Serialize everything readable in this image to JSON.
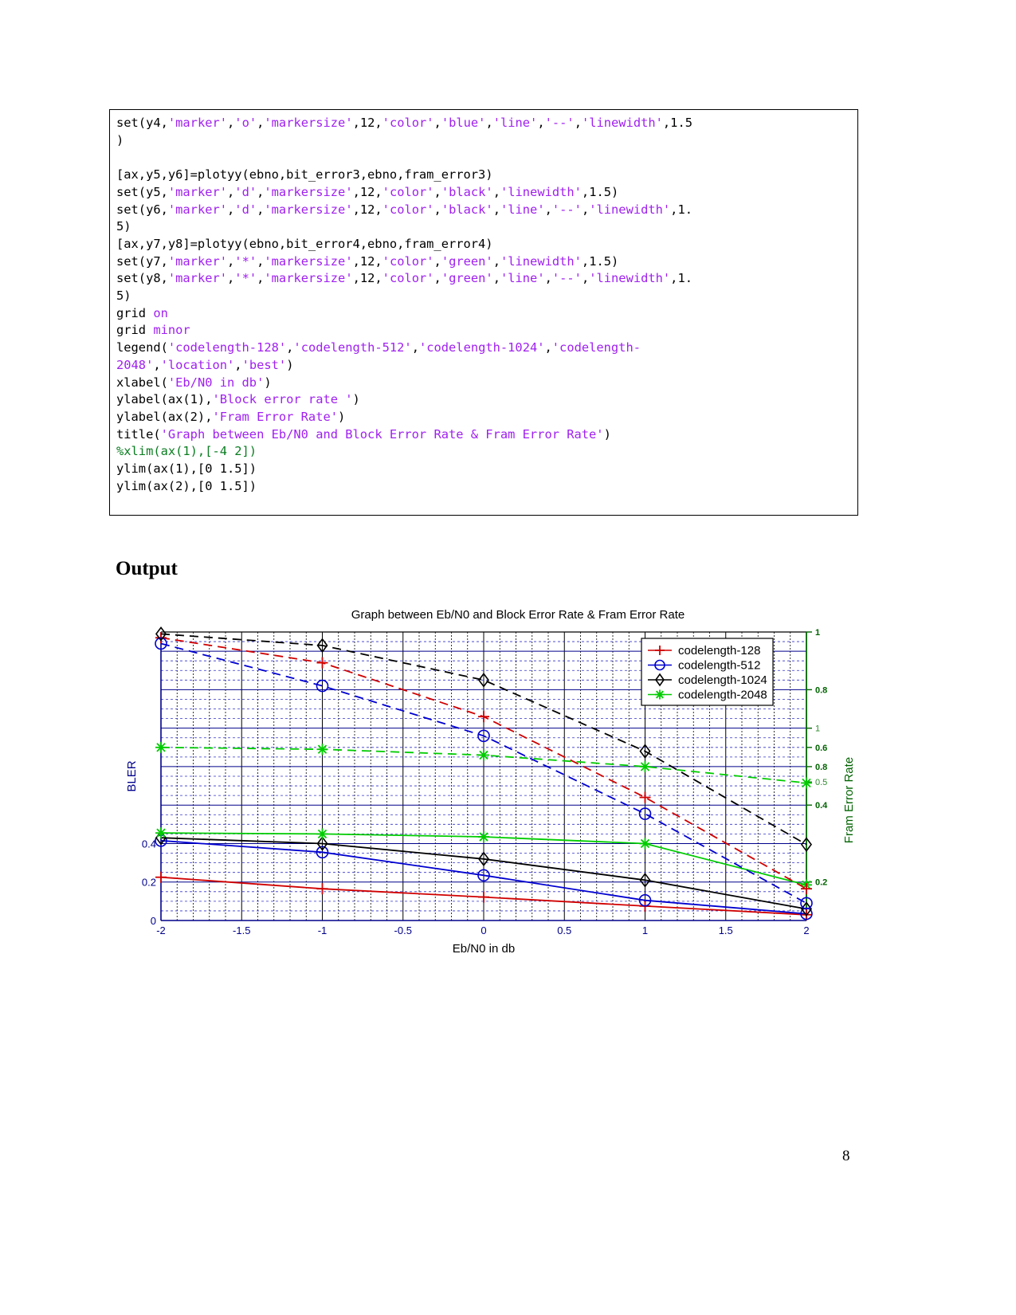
{
  "document": {
    "page_number": "8",
    "output_heading": "Output"
  },
  "code_block": {
    "lines": [
      [
        {
          "t": "set(y4,",
          "k": "p"
        },
        {
          "t": "'marker'",
          "k": "s"
        },
        {
          "t": ",",
          "k": "p"
        },
        {
          "t": "'o'",
          "k": "s"
        },
        {
          "t": ",",
          "k": "p"
        },
        {
          "t": "'markersize'",
          "k": "s"
        },
        {
          "t": ",12,",
          "k": "p"
        },
        {
          "t": "'color'",
          "k": "s"
        },
        {
          "t": ",",
          "k": "p"
        },
        {
          "t": "'blue'",
          "k": "s"
        },
        {
          "t": ",",
          "k": "p"
        },
        {
          "t": "'line'",
          "k": "s"
        },
        {
          "t": ",",
          "k": "p"
        },
        {
          "t": "'--'",
          "k": "s"
        },
        {
          "t": ",",
          "k": "p"
        },
        {
          "t": "'linewidth'",
          "k": "s"
        },
        {
          "t": ",1.5",
          "k": "p"
        }
      ],
      [
        {
          "t": ")",
          "k": "p"
        }
      ],
      [
        {
          "t": "",
          "k": "p"
        }
      ],
      [
        {
          "t": "[ax,y5,y6]=plotyy(ebno,bit_error3,ebno,fram_error3)",
          "k": "p"
        }
      ],
      [
        {
          "t": "set(y5,",
          "k": "p"
        },
        {
          "t": "'marker'",
          "k": "s"
        },
        {
          "t": ",",
          "k": "p"
        },
        {
          "t": "'d'",
          "k": "s"
        },
        {
          "t": ",",
          "k": "p"
        },
        {
          "t": "'markersize'",
          "k": "s"
        },
        {
          "t": ",12,",
          "k": "p"
        },
        {
          "t": "'color'",
          "k": "s"
        },
        {
          "t": ",",
          "k": "p"
        },
        {
          "t": "'black'",
          "k": "s"
        },
        {
          "t": ",",
          "k": "p"
        },
        {
          "t": "'linewidth'",
          "k": "s"
        },
        {
          "t": ",1.5)",
          "k": "p"
        }
      ],
      [
        {
          "t": "set(y6,",
          "k": "p"
        },
        {
          "t": "'marker'",
          "k": "s"
        },
        {
          "t": ",",
          "k": "p"
        },
        {
          "t": "'d'",
          "k": "s"
        },
        {
          "t": ",",
          "k": "p"
        },
        {
          "t": "'markersize'",
          "k": "s"
        },
        {
          "t": ",12,",
          "k": "p"
        },
        {
          "t": "'color'",
          "k": "s"
        },
        {
          "t": ",",
          "k": "p"
        },
        {
          "t": "'black'",
          "k": "s"
        },
        {
          "t": ",",
          "k": "p"
        },
        {
          "t": "'line'",
          "k": "s"
        },
        {
          "t": ",",
          "k": "p"
        },
        {
          "t": "'--'",
          "k": "s"
        },
        {
          "t": ",",
          "k": "p"
        },
        {
          "t": "'linewidth'",
          "k": "s"
        },
        {
          "t": ",1.",
          "k": "p"
        }
      ],
      [
        {
          "t": "5)",
          "k": "p"
        }
      ],
      [
        {
          "t": "[ax,y7,y8]=plotyy(ebno,bit_error4,ebno,fram_error4)",
          "k": "p"
        }
      ],
      [
        {
          "t": "set(y7,",
          "k": "p"
        },
        {
          "t": "'marker'",
          "k": "s"
        },
        {
          "t": ",",
          "k": "p"
        },
        {
          "t": "'*'",
          "k": "s"
        },
        {
          "t": ",",
          "k": "p"
        },
        {
          "t": "'markersize'",
          "k": "s"
        },
        {
          "t": ",12,",
          "k": "p"
        },
        {
          "t": "'color'",
          "k": "s"
        },
        {
          "t": ",",
          "k": "p"
        },
        {
          "t": "'green'",
          "k": "s"
        },
        {
          "t": ",",
          "k": "p"
        },
        {
          "t": "'linewidth'",
          "k": "s"
        },
        {
          "t": ",1.5)",
          "k": "p"
        }
      ],
      [
        {
          "t": "set(y8,",
          "k": "p"
        },
        {
          "t": "'marker'",
          "k": "s"
        },
        {
          "t": ",",
          "k": "p"
        },
        {
          "t": "'*'",
          "k": "s"
        },
        {
          "t": ",",
          "k": "p"
        },
        {
          "t": "'markersize'",
          "k": "s"
        },
        {
          "t": ",12,",
          "k": "p"
        },
        {
          "t": "'color'",
          "k": "s"
        },
        {
          "t": ",",
          "k": "p"
        },
        {
          "t": "'green'",
          "k": "s"
        },
        {
          "t": ",",
          "k": "p"
        },
        {
          "t": "'line'",
          "k": "s"
        },
        {
          "t": ",",
          "k": "p"
        },
        {
          "t": "'--'",
          "k": "s"
        },
        {
          "t": ",",
          "k": "p"
        },
        {
          "t": "'linewidth'",
          "k": "s"
        },
        {
          "t": ",1.",
          "k": "p"
        }
      ],
      [
        {
          "t": "5)",
          "k": "p"
        }
      ],
      [
        {
          "t": "grid ",
          "k": "p"
        },
        {
          "t": "on",
          "k": "s"
        }
      ],
      [
        {
          "t": "grid ",
          "k": "p"
        },
        {
          "t": "minor",
          "k": "s"
        }
      ],
      [
        {
          "t": "legend(",
          "k": "p"
        },
        {
          "t": "'codelength-128'",
          "k": "s"
        },
        {
          "t": ",",
          "k": "p"
        },
        {
          "t": "'codelength-512'",
          "k": "s"
        },
        {
          "t": ",",
          "k": "p"
        },
        {
          "t": "'codelength-1024'",
          "k": "s"
        },
        {
          "t": ",",
          "k": "p"
        },
        {
          "t": "'codelength-",
          "k": "s"
        }
      ],
      [
        {
          "t": "2048'",
          "k": "s"
        },
        {
          "t": ",",
          "k": "p"
        },
        {
          "t": "'location'",
          "k": "s"
        },
        {
          "t": ",",
          "k": "p"
        },
        {
          "t": "'best'",
          "k": "s"
        },
        {
          "t": ")",
          "k": "p"
        }
      ],
      [
        {
          "t": "xlabel(",
          "k": "p"
        },
        {
          "t": "'Eb/N0 in db'",
          "k": "s"
        },
        {
          "t": ")",
          "k": "p"
        }
      ],
      [
        {
          "t": "ylabel(ax(1),",
          "k": "p"
        },
        {
          "t": "'Block error rate '",
          "k": "s"
        },
        {
          "t": ")",
          "k": "p"
        }
      ],
      [
        {
          "t": "ylabel(ax(2),",
          "k": "p"
        },
        {
          "t": "'Fram Error Rate'",
          "k": "s"
        },
        {
          "t": ")",
          "k": "p"
        }
      ],
      [
        {
          "t": "title(",
          "k": "p"
        },
        {
          "t": "'Graph between Eb/N0 and Block Error Rate & Fram Error Rate'",
          "k": "s"
        },
        {
          "t": ")",
          "k": "p"
        }
      ],
      [
        {
          "t": "%xlim(ax(1),[-4 2])",
          "k": "c"
        }
      ],
      [
        {
          "t": "ylim(ax(1),[0 1.5])",
          "k": "p"
        }
      ],
      [
        {
          "t": "ylim(ax(2),[0 1.5])",
          "k": "p"
        }
      ]
    ]
  },
  "chart_data": {
    "type": "line",
    "title": "Graph between Eb/N0 and Block Error Rate & Fram Error Rate",
    "xlabel": "Eb/N0 in db",
    "ylabel": "BLER",
    "ylabel_right": "Fram Error Rate",
    "x": [
      -2,
      -1,
      0,
      1,
      2
    ],
    "xlim": [
      -2,
      2
    ],
    "xticks": [
      "-2",
      "-1.5",
      "-1",
      "-0.5",
      "0",
      "0.5",
      "1",
      "1.5",
      "2"
    ],
    "xtick_values": [
      -2,
      -1.5,
      -1,
      -0.5,
      0,
      0.5,
      1,
      1.5,
      2
    ],
    "ylim": [
      0,
      1.5
    ],
    "yticks": [
      "0",
      "0.2",
      "0.4"
    ],
    "ytick_values": [
      0,
      0.2,
      0.4
    ],
    "right_axis_ticks": [
      "1",
      "0.8",
      "1",
      "0.6",
      "0.8",
      "0.5",
      "0.4",
      "0.2"
    ],
    "right_axis_tick_values": [
      1.5,
      1.2,
      1.0,
      0.9,
      0.8,
      0.72,
      0.6,
      0.2
    ],
    "grid": true,
    "grid_minor": true,
    "legend_position": "best",
    "series": [
      {
        "name": "codelength-128",
        "color": "#d00000",
        "marker": "plus",
        "axis": "left",
        "style": "solid",
        "values": [
          0.225,
          0.165,
          0.122,
          0.075,
          0.03
        ]
      },
      {
        "name": "codelength-512",
        "color": "#0000d0",
        "marker": "circle",
        "axis": "left",
        "style": "solid",
        "values": [
          0.415,
          0.355,
          0.235,
          0.105,
          0.035
        ]
      },
      {
        "name": "codelength-1024",
        "color": "#000000",
        "marker": "diamond",
        "axis": "left",
        "style": "solid",
        "values": [
          0.43,
          0.4,
          0.32,
          0.21,
          0.06
        ]
      },
      {
        "name": "codelength-2048",
        "color": "#00cc00",
        "marker": "star",
        "axis": "left",
        "style": "solid",
        "values": [
          0.455,
          0.45,
          0.435,
          0.4,
          0.185
        ]
      },
      {
        "name": "codelength-128-fer",
        "color": "#d00000",
        "marker": "plus",
        "axis": "right",
        "style": "dashed",
        "values": [
          1.47,
          1.34,
          1.06,
          0.64,
          0.165
        ]
      },
      {
        "name": "codelength-512-fer",
        "color": "#0000d0",
        "marker": "circle",
        "axis": "right",
        "style": "dashed",
        "values": [
          1.44,
          1.22,
          0.96,
          0.555,
          0.09
        ]
      },
      {
        "name": "codelength-1024-fer",
        "color": "#000000",
        "marker": "diamond",
        "axis": "right",
        "style": "dashed",
        "values": [
          1.49,
          1.43,
          1.25,
          0.88,
          0.395
        ]
      },
      {
        "name": "codelength-2048-fer",
        "color": "#00cc00",
        "marker": "star",
        "axis": "right",
        "style": "dashed",
        "values": [
          0.9,
          0.89,
          0.86,
          0.8,
          0.715
        ]
      }
    ],
    "legend": [
      {
        "label": "codelength-128",
        "color": "#d00000",
        "marker": "plus"
      },
      {
        "label": "codelength-512",
        "color": "#0000d0",
        "marker": "circle"
      },
      {
        "label": "codelength-1024",
        "color": "#000000",
        "marker": "diamond"
      },
      {
        "label": "codelength-2048",
        "color": "#00cc00",
        "marker": "star"
      }
    ]
  }
}
